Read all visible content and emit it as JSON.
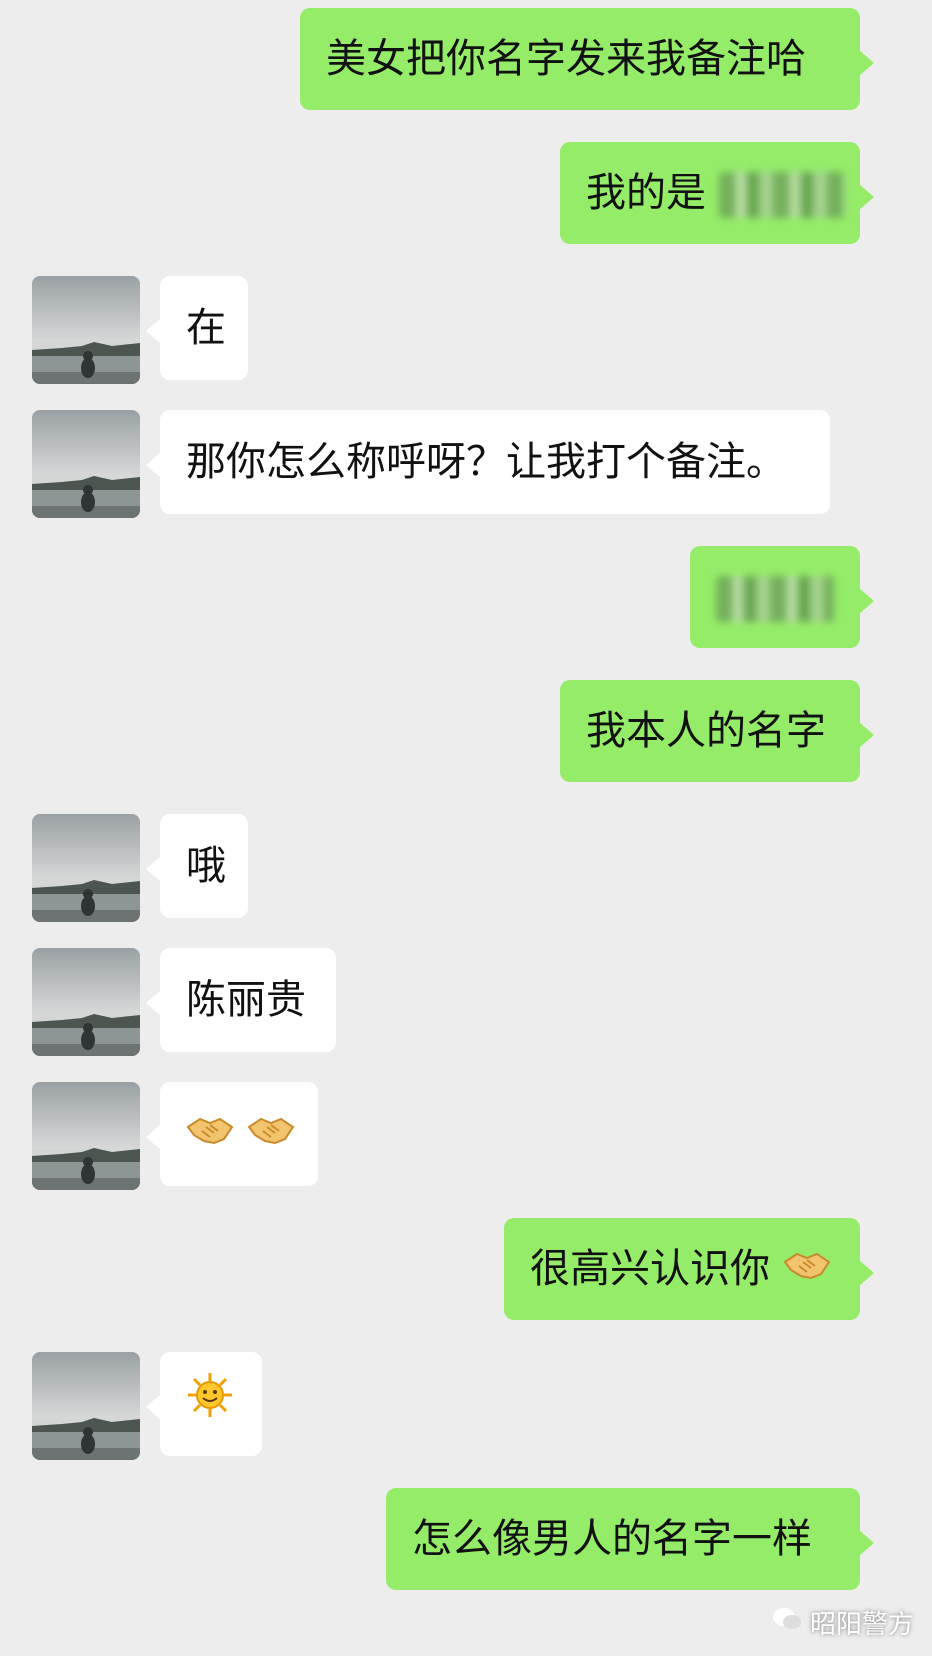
{
  "messages": [
    {
      "side": "right",
      "text": "美女把你名字发来我备注哈"
    },
    {
      "side": "right",
      "text": "我的是",
      "redacted": true
    },
    {
      "side": "left",
      "text": "在"
    },
    {
      "side": "left",
      "text": "那你怎么称呼呀？让我打个备注。"
    },
    {
      "side": "right",
      "text": "",
      "redacted": true
    },
    {
      "side": "right",
      "text": "我本人的名字"
    },
    {
      "side": "left",
      "text": "哦"
    },
    {
      "side": "left",
      "text": "陈丽贵"
    },
    {
      "side": "left",
      "text": "",
      "emoji": "handshake-handshake"
    },
    {
      "side": "right",
      "text": "很高兴认识你",
      "emoji": "handshake"
    },
    {
      "side": "left",
      "text": "",
      "emoji": "sun"
    },
    {
      "side": "right",
      "text": "怎么像男人的名字一样"
    }
  ],
  "watermark": {
    "text": "昭阳警方",
    "icon": "wechat-official-icon"
  },
  "colors": {
    "background": "#ededed",
    "sent_bubble": "#95ec69",
    "received_bubble": "#ffffff"
  }
}
